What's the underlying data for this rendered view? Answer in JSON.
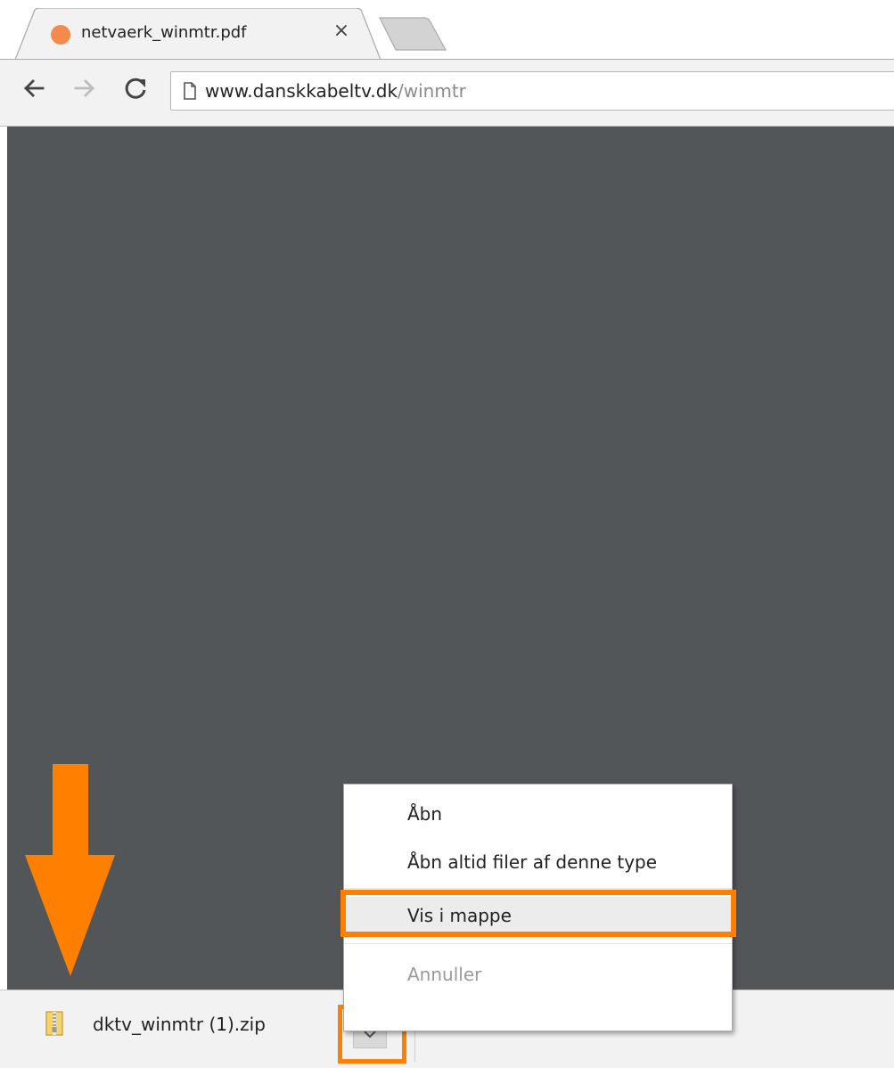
{
  "tab": {
    "title": "netvaerk_winmtr.pdf",
    "close_glyph": "×",
    "favicon_color": "#f48a4c"
  },
  "toolbar": {
    "back_icon": "back-arrow-icon",
    "forward_icon": "forward-arrow-icon",
    "reload_icon": "reload-icon",
    "url_host": "www.danskkabeltv.dk",
    "url_path": "/winmtr"
  },
  "content": {
    "background": "#525659"
  },
  "download_shelf": {
    "file_name": "dktv_winmtr (1).zip",
    "file_icon": "zip-archive-icon",
    "menu_icon": "chevron-down-icon"
  },
  "context_menu": {
    "items": [
      {
        "label": "Åbn",
        "enabled": true
      },
      {
        "label": "Åbn altid filer af denne type",
        "enabled": true
      },
      {
        "label": "Vis i mappe",
        "enabled": true,
        "highlighted": true
      },
      {
        "label": "Annuller",
        "enabled": false
      }
    ]
  },
  "annotation": {
    "accent_color": "#ff8000",
    "arrow_icon": "down-arrow-annotation-icon"
  }
}
